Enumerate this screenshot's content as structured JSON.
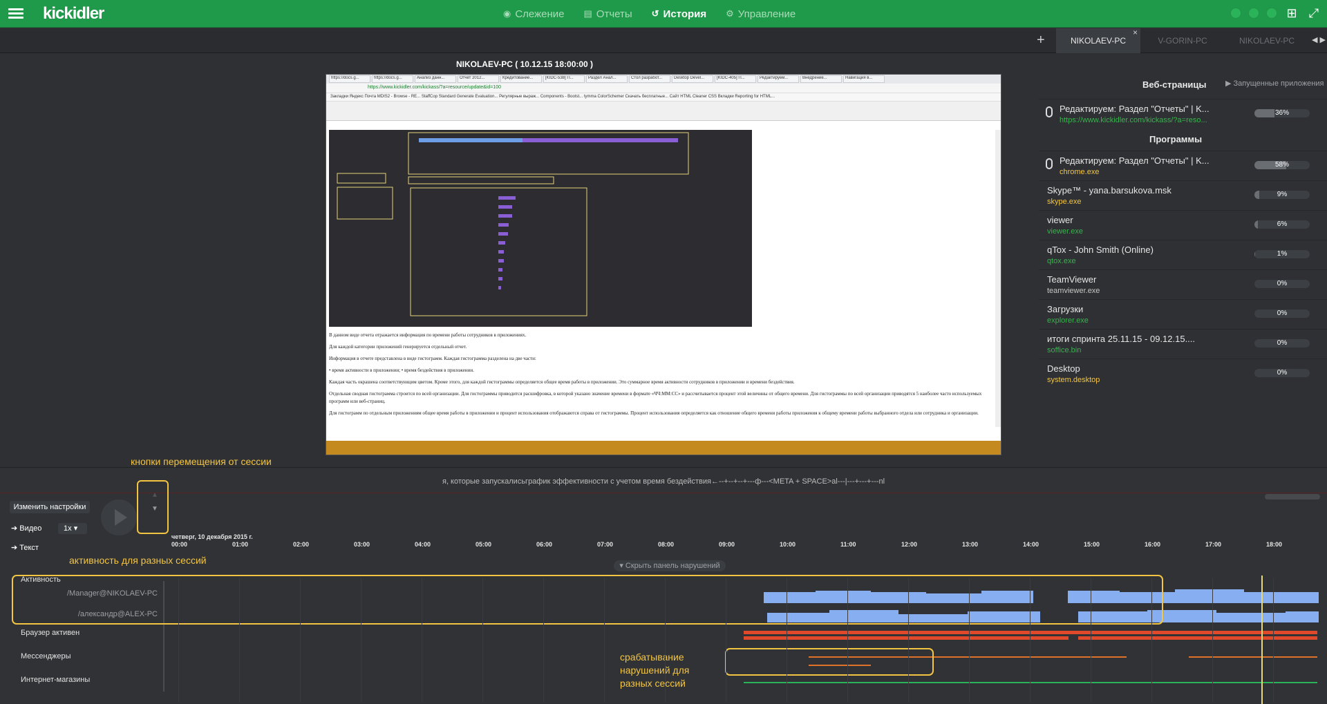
{
  "app": {
    "logo": "kickidler",
    "nav": [
      {
        "label": "Слежение",
        "icon": "eye-icon",
        "active": false
      },
      {
        "label": "Отчеты",
        "icon": "report-icon",
        "active": false
      },
      {
        "label": "История",
        "icon": "history-icon",
        "active": true
      },
      {
        "label": "Управление",
        "icon": "gear-icon",
        "active": false
      }
    ],
    "accent": "#1f9a4a"
  },
  "tabs": [
    {
      "label": "NIKOLAEV-PC",
      "active": true
    },
    {
      "label": "V-GORIN-PC",
      "active": false
    },
    {
      "label": "NIKOLAEV-PC",
      "active": false
    }
  ],
  "session_title": "NIKOLAEV-PC    ( 10.12.15 18:00:00 )",
  "screenshot": {
    "url": "https://www.kickidler.com/kickass/?a=resource/update&id=100",
    "browser_tabs": [
      "https://docs.g...",
      "https://docs.g...",
      "Анализ данн...",
      "Отчет 2012...",
      "Кредитование...",
      "[KIDC-538] П...",
      "Раздел Анал...",
      "Стол разработ...",
      "Desktop Devel...",
      "[KIDC-405] П...",
      "Редактируем...",
      "Внедрение...",
      "Навигация в..."
    ],
    "bookmarks": "Закладки  Яндекс  Почта  MDIS2 - Browse - RE...  StaffCop Standard  Generate Evaluation...  Регулярные выраж...  Components - Bootst...  tymma  ColorSchemer  Скачать бесплатные...  Сайт HTML Cleaner  CSS Вкладки  Reporting for HTML...",
    "paragraphs": [
      "В данном виде отчета отражается информация по времени работы сотрудников в приложениях.",
      "Для каждой категории приложений генерируется отдельный отчет.",
      "Информация в отчете представлена в виде гистограмм. Каждая гистограмма разделена на две части:",
      "• время активности в приложении;  • время бездействия в приложении.",
      "Каждая часть окрашена соответствующим цветом. Кроме этого, для каждой гистограммы определяется общее время работы в приложении. Это суммарное время активности сотрудников в приложении и времени бездействия.",
      "Отдельная сводная гистограмма строится по всей организации. Для гистограммы приводится расшифровка, в которой указано значение времени в формате «ЧЧ:ММ:СС» и рассчитывается процент этой величины от общего времени. Для гистограммы по всей организации приводятся 5 наиболее часто используемых программ или веб-страниц.",
      "Для гистограмм по отдельным приложениям общее время работы в приложении и процент использования отображаются справа от гистограммы. Процент использования определяется как отношение общего времени работы приложения к общему времени работы выбранного отдела или сотрудника и организации."
    ]
  },
  "annotations": {
    "session_nav": "кнопки  перемещения от сессии\n к сессии",
    "activity_sessions": "активность для разных сессий",
    "violations": "срабатывание\nнарушений для\nразных сессий"
  },
  "right_panel": {
    "web_title": "Веб-страницы",
    "running_apps": "Запущенные приложения",
    "programs_title": "Программы",
    "web_items": [
      {
        "name": "Редактируем: Раздел \"Отчеты\" | K...",
        "sub": "https://www.kickidler.com/kickass/?a=reso...",
        "pct": "36%",
        "value": 36,
        "icon": "mouse-icon"
      }
    ],
    "program_items": [
      {
        "name": "Редактируем: Раздел \"Отчеты\" | K...",
        "sub": "chrome.exe",
        "pct": "58%",
        "value": 58,
        "icon": "mouse-icon",
        "subcolor": "#f4c542"
      },
      {
        "name": "Skype™ - yana.barsukova.msk",
        "sub": "skype.exe",
        "pct": "9%",
        "value": 9,
        "subcolor": "#f4c542"
      },
      {
        "name": "viewer",
        "sub": "viewer.exe",
        "pct": "6%",
        "value": 6,
        "subcolor": "#3ab24f"
      },
      {
        "name": "qTox - John Smith (Online)",
        "sub": "qtox.exe",
        "pct": "1%",
        "value": 1,
        "subcolor": "#3ab24f"
      },
      {
        "name": "TeamViewer",
        "sub": "teamviewer.exe",
        "pct": "0%",
        "value": 0,
        "subcolor": "#c7c7c7"
      },
      {
        "name": "Загрузки",
        "sub": "explorer.exe",
        "pct": "0%",
        "value": 0,
        "subcolor": "#3ab24f"
      },
      {
        "name": "итоги спринта 25.11.15 - 09.12.15....",
        "sub": "soffice.bin",
        "pct": "0%",
        "value": 0,
        "subcolor": "#3ab24f"
      },
      {
        "name": "Desktop",
        "sub": "system.desktop",
        "pct": "0%",
        "value": 0,
        "subcolor": "#f4c542"
      }
    ]
  },
  "timeline": {
    "marquee": "я, которые запускалисьграфик эффективности с учетом время бездействия←--+--+--+---ф---<META + SPACE>al---|---+---+---nl",
    "change_settings": "Изменить настройки",
    "video": "Видео",
    "speed": "1x",
    "text": "Текст",
    "date": "четверг, 10 декабря 2015 г.",
    "hours": [
      "00:00",
      "01:00",
      "02:00",
      "03:00",
      "04:00",
      "05:00",
      "06:00",
      "07:00",
      "08:00",
      "09:00",
      "10:00",
      "11:00",
      "12:00",
      "13:00",
      "14:00",
      "15:00",
      "16:00",
      "17:00",
      "18:00"
    ],
    "hide_panel": "Скрыть панель нарушений",
    "rows": {
      "activity": "Активность",
      "user1": "/Manager@NIKOLAEV-PC",
      "user2": "/александр@ALEX-PC",
      "browser": "Браузер активен",
      "messengers": "Мессенджеры",
      "shops": "Интернет-магазины"
    },
    "colors": {
      "activity": "#86aef0",
      "browser": "#e04a2a",
      "messengers": "#e0722a",
      "shops": "#2bb35a"
    }
  }
}
